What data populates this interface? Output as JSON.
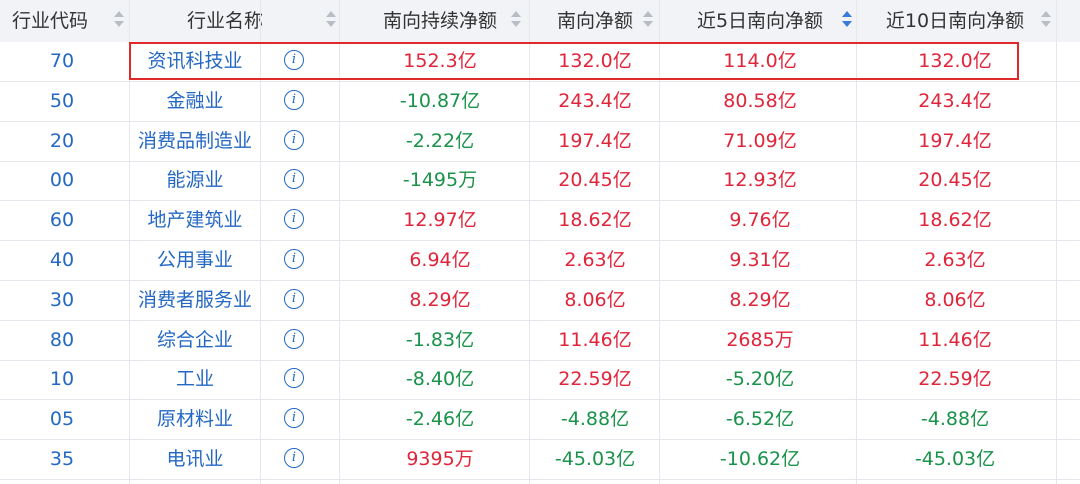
{
  "headers": {
    "code": "行业代码",
    "name": "行业名称",
    "cont": "南向持续净额",
    "net": "南向净额",
    "n5": "近5日南向净额",
    "n10": "近10日南向净额"
  },
  "rows": [
    {
      "code": "70",
      "name": "资讯科技业",
      "cont": "152.3亿",
      "net": "132.0亿",
      "n5": "114.0亿",
      "n10": "132.0亿"
    },
    {
      "code": "50",
      "name": "金融业",
      "cont": "-10.87亿",
      "net": "243.4亿",
      "n5": "80.58亿",
      "n10": "243.4亿"
    },
    {
      "code": "20",
      "name": "消费品制造业",
      "cont": "-2.22亿",
      "net": "197.4亿",
      "n5": "71.09亿",
      "n10": "197.4亿"
    },
    {
      "code": "00",
      "name": "能源业",
      "cont": "-1495万",
      "net": "20.45亿",
      "n5": "12.93亿",
      "n10": "20.45亿"
    },
    {
      "code": "60",
      "name": "地产建筑业",
      "cont": "12.97亿",
      "net": "18.62亿",
      "n5": "9.76亿",
      "n10": "18.62亿"
    },
    {
      "code": "40",
      "name": "公用事业",
      "cont": "6.94亿",
      "net": "2.63亿",
      "n5": "9.31亿",
      "n10": "2.63亿"
    },
    {
      "code": "30",
      "name": "消费者服务业",
      "cont": "8.29亿",
      "net": "8.06亿",
      "n5": "8.29亿",
      "n10": "8.06亿"
    },
    {
      "code": "80",
      "name": "综合企业",
      "cont": "-1.83亿",
      "net": "11.46亿",
      "n5": "2685万",
      "n10": "11.46亿"
    },
    {
      "code": "10",
      "name": "工业",
      "cont": "-8.40亿",
      "net": "22.59亿",
      "n5": "-5.20亿",
      "n10": "22.59亿"
    },
    {
      "code": "05",
      "name": "原材料业",
      "cont": "-2.46亿",
      "net": "-4.88亿",
      "n5": "-6.52亿",
      "n10": "-4.88亿"
    },
    {
      "code": "35",
      "name": "电讯业",
      "cont": "9395万",
      "net": "-45.03亿",
      "n5": "-10.62亿",
      "n10": "-45.03亿"
    }
  ],
  "colors": {
    "positive": "#e0243a",
    "negative": "#19924a",
    "link": "#2468c4",
    "highlight": "#e02a2a"
  },
  "icons": {
    "info": "info-circle-icon",
    "sort": "sort-icon"
  },
  "active_sort_column": "n5",
  "highlighted_row": 0
}
